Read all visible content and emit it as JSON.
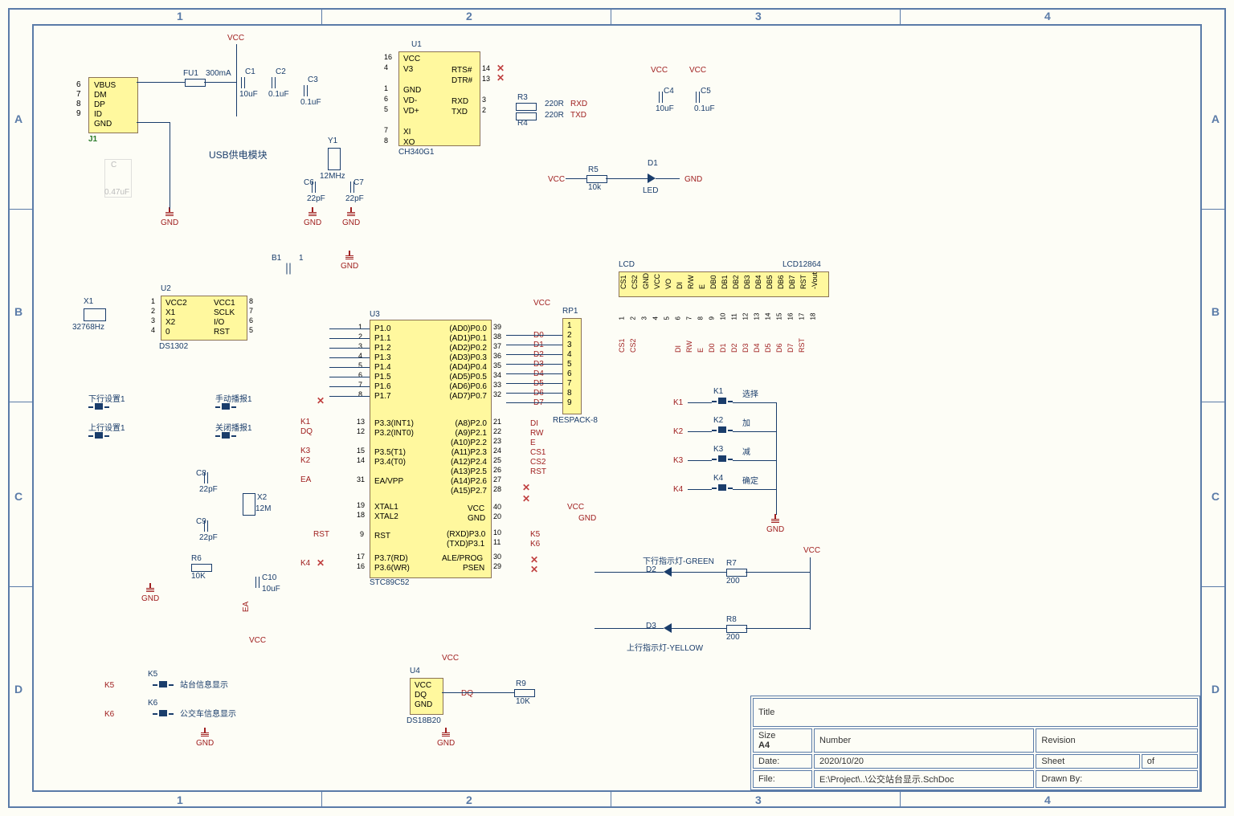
{
  "grid": {
    "cols": [
      "1",
      "2",
      "3",
      "4"
    ],
    "rows": [
      "A",
      "B",
      "C",
      "D"
    ]
  },
  "usb": {
    "conn": {
      "ref": "J1",
      "pins": [
        "VBUS",
        "DM",
        "DP",
        "ID",
        "GND"
      ],
      "pin_nums": [
        "6",
        "7",
        "8",
        "9"
      ]
    },
    "fuse": {
      "ref": "FU1",
      "val": "300mA"
    },
    "c1": {
      "ref": "C1",
      "val": "10uF"
    },
    "c2": {
      "ref": "C2",
      "val": "0.1uF"
    },
    "c3": {
      "ref": "C3",
      "val": "0.1uF"
    },
    "label": "USB供电模块",
    "vcc": "VCC",
    "gnd": "GND",
    "c_strike": {
      "ref": "C",
      "val": "0.47uF"
    }
  },
  "ch340": {
    "ref": "U1",
    "part": "CH340G1",
    "left": [
      "VCC",
      "V3",
      "",
      "GND",
      "VD-",
      "VD+",
      "",
      "XI",
      "XO"
    ],
    "left_nums": [
      "16",
      "4",
      "",
      "1",
      "6",
      "5",
      "",
      "7",
      "8"
    ],
    "right": [
      "RTS#",
      "DTR#",
      "",
      "RXD",
      "TXD"
    ],
    "right_nums": [
      "14",
      "13",
      "",
      "3",
      "2"
    ],
    "r3": {
      "ref": "R3",
      "val": "220R"
    },
    "r4": {
      "ref": "R4",
      "val": "220R"
    },
    "net_rxd": "RXD",
    "net_txd": "TXD"
  },
  "xtal_usb": {
    "ref": "Y1",
    "val": "12MHz",
    "c6": {
      "ref": "C6",
      "val": "22pF"
    },
    "c7": {
      "ref": "C7",
      "val": "22pF"
    }
  },
  "pwr_caps": {
    "c4": {
      "ref": "C4",
      "val": "10uF"
    },
    "c5": {
      "ref": "C5",
      "val": "0.1uF"
    },
    "vcc1": "VCC",
    "vcc2": "VCC"
  },
  "led_pwr": {
    "r5": {
      "ref": "R5",
      "val": "10k"
    },
    "d1": {
      "ref": "D1",
      "part": "LED"
    },
    "vcc": "VCC",
    "gnd": "GND"
  },
  "ds1302": {
    "ref": "U2",
    "part": "DS1302",
    "x1": {
      "ref": "X1",
      "val": "32768Hz"
    },
    "b1": "B1",
    "gnd": "GND",
    "left": [
      "VCC2",
      "X1",
      "X2",
      "0"
    ],
    "right": [
      "VCC1",
      "SCLK",
      "I/O",
      "RST"
    ],
    "pin_l": [
      "1",
      "2",
      "3",
      "4"
    ],
    "pin_r": [
      "8",
      "7",
      "6",
      "5"
    ]
  },
  "mcu": {
    "ref": "U3",
    "part": "STC89C52",
    "p1": [
      "P1.0",
      "P1.1",
      "P1.2",
      "P1.3",
      "P1.4",
      "P1.5",
      "P1.6",
      "P1.7"
    ],
    "p1_nums": [
      "1",
      "2",
      "3",
      "4",
      "5",
      "6",
      "7",
      "8"
    ],
    "p3int": [
      "P3.3(INT1)",
      "P3.2(INT0)"
    ],
    "p3int_nums": [
      "13",
      "12"
    ],
    "p3t": [
      "P3.5(T1)",
      "P3.4(T0)"
    ],
    "p3t_nums": [
      "15",
      "14"
    ],
    "ea": "EA/VPP",
    "ea_num": "31",
    "xtal": [
      "XTAL1",
      "XTAL2"
    ],
    "xtal_nums": [
      "19",
      "18"
    ],
    "rst": "RST",
    "rst_num": "9",
    "p3rw": [
      "P3.7(RD)",
      "P3.6(WR)"
    ],
    "p3rw_nums": [
      "17",
      "16"
    ],
    "p0": [
      "(AD0)P0.0",
      "(AD1)P0.1",
      "(AD2)P0.2",
      "(AD3)P0.3",
      "(AD4)P0.4",
      "(AD5)P0.5",
      "(AD6)P0.6",
      "(AD7)P0.7"
    ],
    "p0_nums": [
      "39",
      "38",
      "37",
      "36",
      "35",
      "34",
      "33",
      "32"
    ],
    "p2": [
      "(A8)P2.0",
      "(A9)P2.1",
      "(A10)P2.2",
      "(A11)P2.3",
      "(A12)P2.4",
      "(A13)P2.5",
      "(A14)P2.6",
      "(A15)P2.7"
    ],
    "p2_nums": [
      "21",
      "22",
      "23",
      "24",
      "25",
      "26",
      "27",
      "28"
    ],
    "vcc": "VCC",
    "vcc_num": "40",
    "gnd": "GND",
    "gnd_num": "20",
    "rxd": "(RXD)P3.0",
    "rxd_num": "10",
    "txd": "(TXD)P3.1",
    "txd_num": "11",
    "ale": "ALE/PROG",
    "ale_num": "30",
    "psen": "PSEN",
    "psen_num": "29"
  },
  "mcu_xtal": {
    "x2": {
      "ref": "X2",
      "val": "12M"
    },
    "c8": {
      "ref": "C8",
      "val": "22pF"
    },
    "c9": {
      "ref": "C9",
      "val": "22pF"
    }
  },
  "mcu_rst": {
    "r6": {
      "ref": "R6",
      "val": "10K"
    },
    "c10": {
      "ref": "C10",
      "val": "10uF"
    },
    "net": "RST",
    "gnd": "GND",
    "vcc": "VCC",
    "ea": "EA"
  },
  "respack": {
    "ref": "RP1",
    "part": "RESPACK-8",
    "pins": [
      "1",
      "2",
      "3",
      "4",
      "5",
      "6",
      "7",
      "8",
      "9"
    ],
    "nets": [
      "D0",
      "D1",
      "D2",
      "D3",
      "D4",
      "D5",
      "D6",
      "D7"
    ],
    "vcc": "VCC"
  },
  "p2nets": [
    "DI",
    "RW",
    "E",
    "CS1",
    "CS2",
    "RST"
  ],
  "p3nets_l": {
    "k1": "K1",
    "dq": "DQ",
    "k3": "K3",
    "k2": "K2",
    "ea": "EA",
    "rst": "RST",
    "k4": "K4"
  },
  "p3nets_r": {
    "k5": "K5",
    "k6": "K6"
  },
  "lcd": {
    "label": "LCD",
    "part": "LCD12864",
    "top": [
      "CS1",
      "CS2",
      "GND",
      "VCC",
      "VO",
      "DI",
      "R/W",
      "E",
      "DB0",
      "DB1",
      "DB2",
      "DB3",
      "DB4",
      "DB5",
      "DB6",
      "DB7",
      "RST",
      "-Vout"
    ],
    "nums": [
      "1",
      "2",
      "3",
      "4",
      "5",
      "6",
      "7",
      "8",
      "9",
      "10",
      "11",
      "12",
      "13",
      "14",
      "15",
      "16",
      "17",
      "18"
    ],
    "nets": [
      "CS1",
      "CS2",
      "",
      "",
      "",
      "DI",
      "RW",
      "E",
      "D0",
      "D1",
      "D2",
      "D3",
      "D4",
      "D5",
      "D6",
      "D7",
      "RST",
      ""
    ]
  },
  "keys": {
    "k": [
      {
        "net": "K1",
        "ref": "K1",
        "label": "选择"
      },
      {
        "net": "K2",
        "ref": "K2",
        "label": "加"
      },
      {
        "net": "K3",
        "ref": "K3",
        "label": "减"
      },
      {
        "net": "K4",
        "ref": "K4",
        "label": "确定"
      }
    ],
    "gnd": "GND"
  },
  "side_sw": {
    "a": [
      {
        "label": "下行设置1"
      },
      {
        "label": "上行设置1"
      }
    ],
    "b": [
      {
        "label": "手动播报1"
      },
      {
        "label": "关闭播报1"
      }
    ]
  },
  "leds": {
    "d2": {
      "ref": "D2",
      "label": "下行指示灯-GREEN"
    },
    "d3": {
      "ref": "D3",
      "label": "上行指示灯-YELLOW"
    },
    "r7": {
      "ref": "R7",
      "val": "200"
    },
    "r8": {
      "ref": "R8",
      "val": "200"
    },
    "vcc": "VCC"
  },
  "lower_sw": {
    "k5": {
      "net": "K5",
      "ref": "K5",
      "label": "站台信息显示"
    },
    "k6": {
      "net": "K6",
      "ref": "K6",
      "label": "公交车信息显示"
    },
    "gnd": "GND"
  },
  "ds18b20": {
    "ref": "U4",
    "part": "DS18B20",
    "pins": [
      "VCC",
      "DQ",
      "GND"
    ],
    "net": "DQ",
    "r9": {
      "ref": "R9",
      "val": "10K"
    },
    "vcc": "VCC",
    "gnd": "GND"
  },
  "title": {
    "title": "Title",
    "size_lbl": "Size",
    "size": "A4",
    "number_lbl": "Number",
    "rev_lbl": "Revision",
    "date_lbl": "Date:",
    "date": "2020/10/20",
    "sheet_lbl": "Sheet",
    "sheet": "of",
    "file_lbl": "File:",
    "file": "E:\\Project\\..\\公交站台显示.SchDoc",
    "drawn_lbl": "Drawn By:"
  }
}
